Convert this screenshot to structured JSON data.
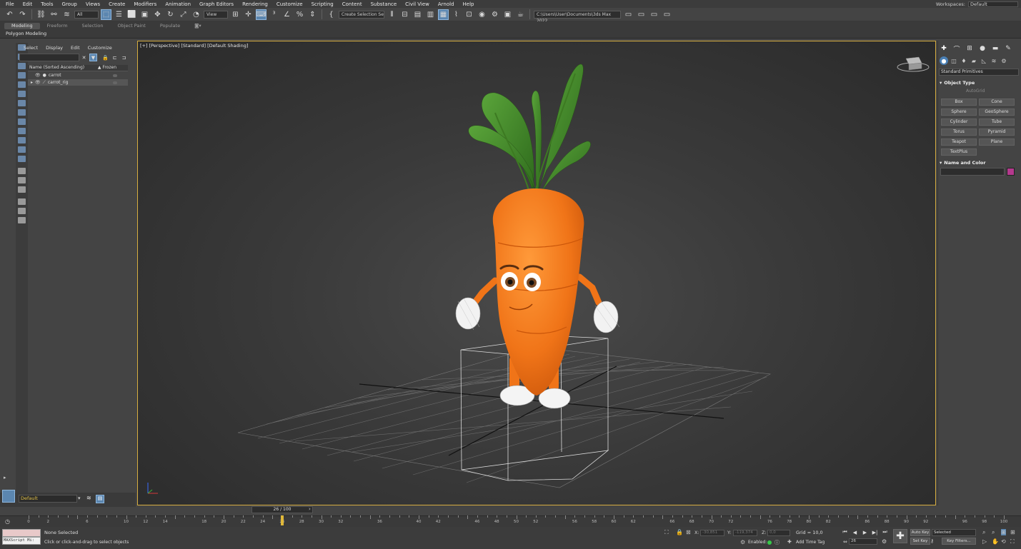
{
  "menu": [
    "File",
    "Edit",
    "Tools",
    "Group",
    "Views",
    "Create",
    "Modifiers",
    "Animation",
    "Graph Editors",
    "Rendering",
    "Customize",
    "Scripting",
    "Content",
    "Substance",
    "Civil View",
    "Arnold",
    "Help"
  ],
  "workspace": {
    "label": "Workspaces:",
    "value": "Default"
  },
  "toolbar": {
    "filter_value": "All",
    "refcoord_value": "View",
    "selection_set": "Create Selection Se",
    "project_path": "C:\\Users\\User\\Documents\\3ds Max 2022"
  },
  "ribbon": {
    "tabs": [
      "Modeling",
      "Freeform",
      "Selection",
      "Object Paint",
      "Populate"
    ],
    "active_tab": "Modeling",
    "sub_label": "Polygon Modeling"
  },
  "explorer": {
    "menu": [
      "Select",
      "Display",
      "Edit",
      "Customize"
    ],
    "col_name": "Name (Sorted Ascending)",
    "col_frozen": "▲ Frozen",
    "rows": [
      "carrot",
      "carrot_rig"
    ]
  },
  "layer": {
    "value": "Default"
  },
  "viewport": {
    "label": "[+] [Perspective] [Standard] [Default Shading]"
  },
  "command_panel": {
    "primitive_type": "Standard Primitives",
    "object_type_title": "Object Type",
    "autogrid": "AutoGrid",
    "buttons": [
      "Box",
      "Cone",
      "Sphere",
      "GeoSphere",
      "Cylinder",
      "Tube",
      "Torus",
      "Pyramid",
      "Teapot",
      "Plane",
      "TextPlus"
    ],
    "name_color_title": "Name and Color",
    "object_color": "#b5398e"
  },
  "timeline": {
    "slider_label": "26 / 100",
    "current_frame": 26,
    "start": 0,
    "end": 100,
    "tick_labels": [
      "0",
      "2",
      "6",
      "10",
      "12",
      "14",
      "18",
      "20",
      "22",
      "24",
      "26",
      "28",
      "30",
      "32",
      "36",
      "40",
      "42",
      "46",
      "48",
      "50",
      "52",
      "56",
      "58",
      "60",
      "62",
      "66",
      "68",
      "70",
      "72",
      "76",
      "78",
      "80",
      "82",
      "86",
      "88",
      "90",
      "92",
      "96",
      "98",
      "100"
    ]
  },
  "status": {
    "maxscript": "MAXScript Mi:",
    "selection": "None Selected",
    "prompt": "Click or click-and-drag to select objects",
    "x_label": "X:",
    "x_value": "-30,851",
    "y_label": "Y:",
    "y_value": "-119,374",
    "z_label": "Z:",
    "z_value": "0,0",
    "grid": "Grid = 10,0",
    "enabled": "Enabled:",
    "add_time_tag": "Add Time Tag",
    "auto_key": "Auto Key",
    "set_key": "Set Key",
    "selected_dd": "Selected",
    "key_filters": "Key Filters...",
    "frame_value": "26"
  }
}
